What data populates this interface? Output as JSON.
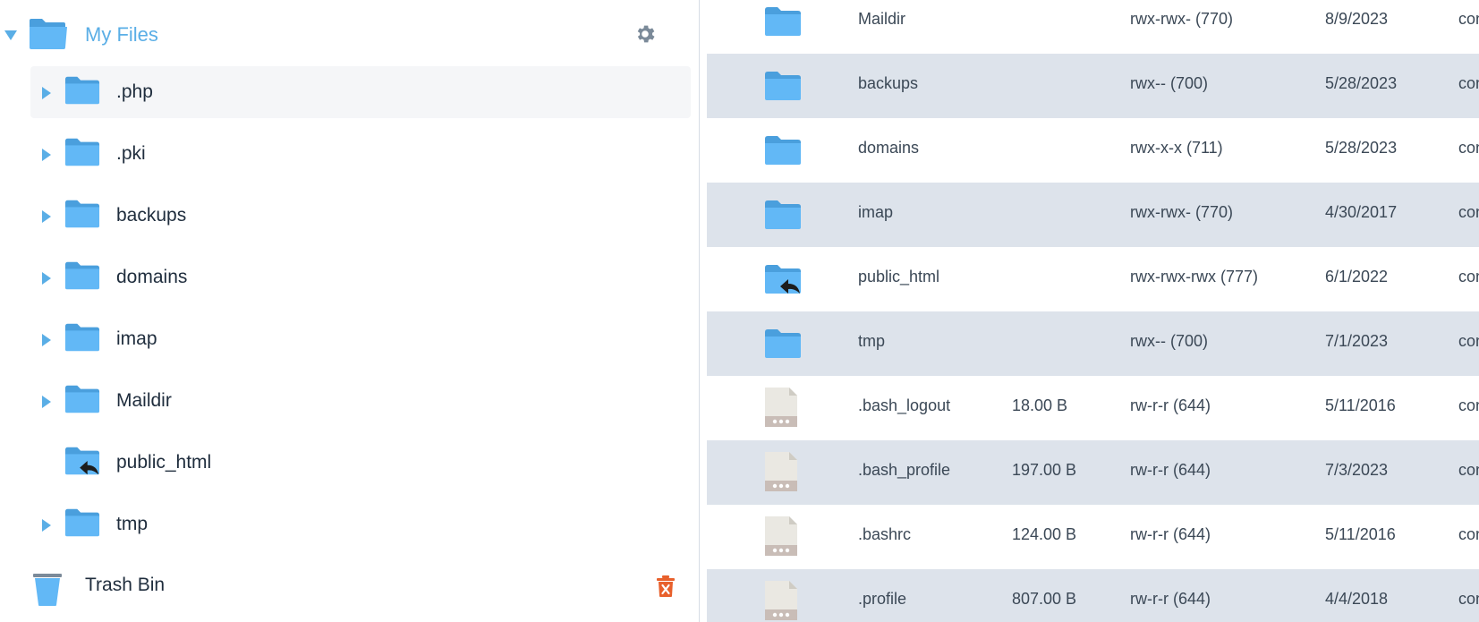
{
  "sidebar": {
    "root_label": "My Files",
    "tree": [
      {
        "label": ".php",
        "expandable": true,
        "active": true,
        "symlink": false
      },
      {
        "label": ".pki",
        "expandable": true,
        "active": false,
        "symlink": false
      },
      {
        "label": "backups",
        "expandable": true,
        "active": false,
        "symlink": false
      },
      {
        "label": "domains",
        "expandable": true,
        "active": false,
        "symlink": false
      },
      {
        "label": "imap",
        "expandable": true,
        "active": false,
        "symlink": false
      },
      {
        "label": "Maildir",
        "expandable": true,
        "active": false,
        "symlink": false
      },
      {
        "label": "public_html",
        "expandable": false,
        "active": false,
        "symlink": true
      },
      {
        "label": "tmp",
        "expandable": true,
        "active": false,
        "symlink": false
      }
    ],
    "trash_label": "Trash Bin"
  },
  "files": [
    {
      "name": "Maildir",
      "size": "",
      "perm": "rwx-rwx- (770)",
      "date": "8/9/2023",
      "owner": "con",
      "kind": "folder"
    },
    {
      "name": "backups",
      "size": "",
      "perm": "rwx-- (700)",
      "date": "5/28/2023",
      "owner": "con",
      "kind": "folder"
    },
    {
      "name": "domains",
      "size": "",
      "perm": "rwx-x-x (711)",
      "date": "5/28/2023",
      "owner": "con",
      "kind": "folder"
    },
    {
      "name": "imap",
      "size": "",
      "perm": "rwx-rwx- (770)",
      "date": "4/30/2017",
      "owner": "con",
      "kind": "folder"
    },
    {
      "name": "public_html",
      "size": "",
      "perm": "rwx-rwx-rwx (777)",
      "date": "6/1/2022",
      "owner": "con",
      "kind": "symlink"
    },
    {
      "name": "tmp",
      "size": "",
      "perm": "rwx-- (700)",
      "date": "7/1/2023",
      "owner": "con",
      "kind": "folder"
    },
    {
      "name": ".bash_logout",
      "size": "18.00 B",
      "perm": "rw-r-r (644)",
      "date": "5/11/2016",
      "owner": "con",
      "kind": "file"
    },
    {
      "name": ".bash_profile",
      "size": "197.00 B",
      "perm": "rw-r-r (644)",
      "date": "7/3/2023",
      "owner": "con",
      "kind": "file"
    },
    {
      "name": ".bashrc",
      "size": "124.00 B",
      "perm": "rw-r-r (644)",
      "date": "5/11/2016",
      "owner": "con",
      "kind": "file"
    },
    {
      "name": ".profile",
      "size": "807.00 B",
      "perm": "rw-r-r (644)",
      "date": "4/4/2018",
      "owner": "con",
      "kind": "file"
    }
  ],
  "colors": {
    "accent": "#5aaee6",
    "folder": "#62b8f6",
    "row_alt": "#dde3eb",
    "danger": "#e8602c"
  },
  "icons": {
    "root": "folder-open-icon",
    "settings": "gear-icon",
    "trash": "trash-bin-icon",
    "empty_trash": "trash-delete-icon",
    "symlink": "symlink-arrow-icon",
    "file": "document-icon"
  }
}
